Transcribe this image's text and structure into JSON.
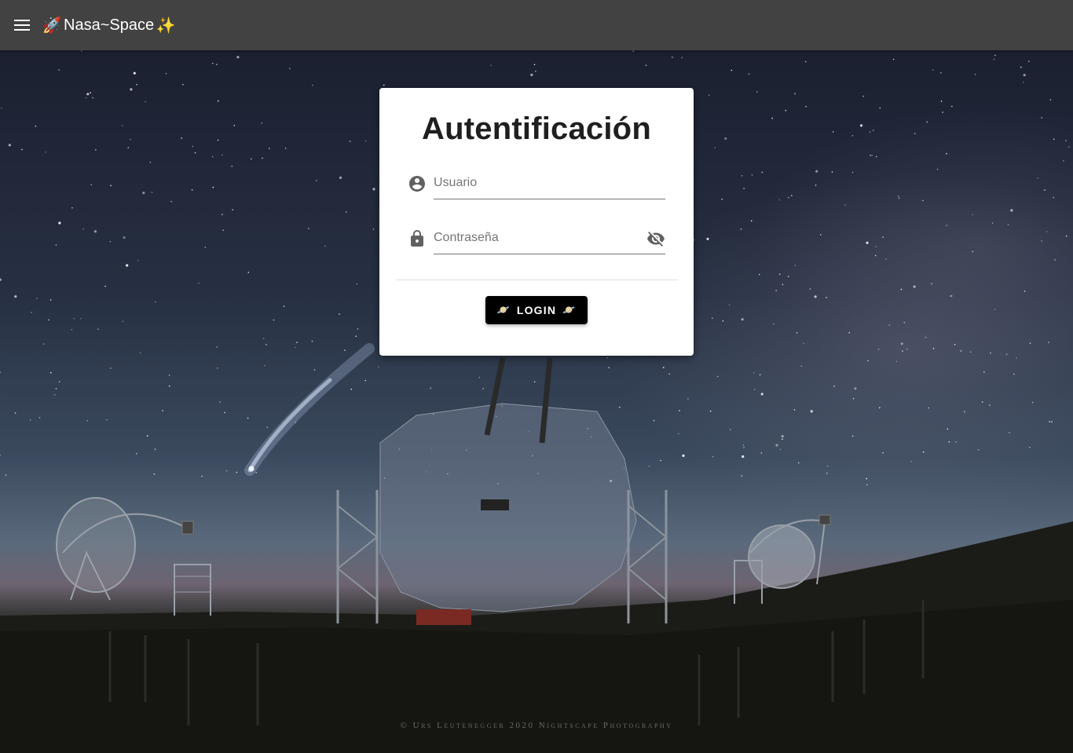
{
  "appbar": {
    "menu_icon": "menu-icon",
    "rocket_emoji": "🚀",
    "title": "Nasa~Space",
    "sparkles_emoji": "✨"
  },
  "login": {
    "heading": "Autentificación",
    "username": {
      "placeholder": "Usuario",
      "value": "",
      "icon": "account-circle-icon"
    },
    "password": {
      "placeholder": "Contraseña",
      "value": "",
      "icon": "lock-icon",
      "toggle_icon": "eye-off-icon"
    },
    "button": {
      "label": "LOGIN",
      "planet_left": "🪐",
      "planet_right": "🪐"
    }
  },
  "background": {
    "credit": "© Urs Leutenegger 2020 Nightscape Photography"
  },
  "colors": {
    "appbar": "#424242",
    "card": "#ffffff",
    "button": "#000000",
    "planet": "#f07b2a"
  }
}
